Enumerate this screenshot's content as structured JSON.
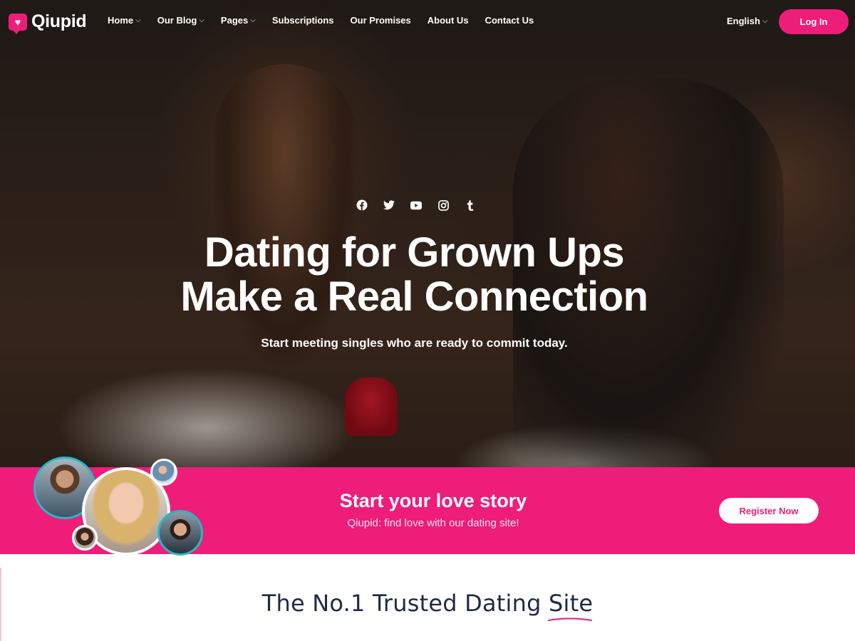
{
  "brand": {
    "name": "Qiupid",
    "accent": "#ee1d7a",
    "secondary": "#2ab7c5"
  },
  "nav": {
    "items": [
      {
        "label": "Home",
        "has_dropdown": true
      },
      {
        "label": "Our Blog",
        "has_dropdown": true
      },
      {
        "label": "Pages",
        "has_dropdown": true
      },
      {
        "label": "Subscriptions",
        "has_dropdown": false
      },
      {
        "label": "Our Promises",
        "has_dropdown": false
      },
      {
        "label": "About Us",
        "has_dropdown": false
      },
      {
        "label": "Contact Us",
        "has_dropdown": false
      }
    ],
    "language": "English",
    "login_label": "Log In"
  },
  "hero": {
    "socials": [
      "facebook-icon",
      "twitter-icon",
      "youtube-icon",
      "instagram-icon",
      "tumblr-icon"
    ],
    "title_line1": "Dating for Grown Ups",
    "title_line2": "Make a Real Connection",
    "subtitle": "Start meeting singles who are ready to commit today."
  },
  "cta_band": {
    "title": "Start your love story",
    "subtitle": "Qiupid: find love with our dating site!",
    "button_label": "Register Now"
  },
  "section": {
    "title": "The No.1 Trusted Dating Site"
  }
}
